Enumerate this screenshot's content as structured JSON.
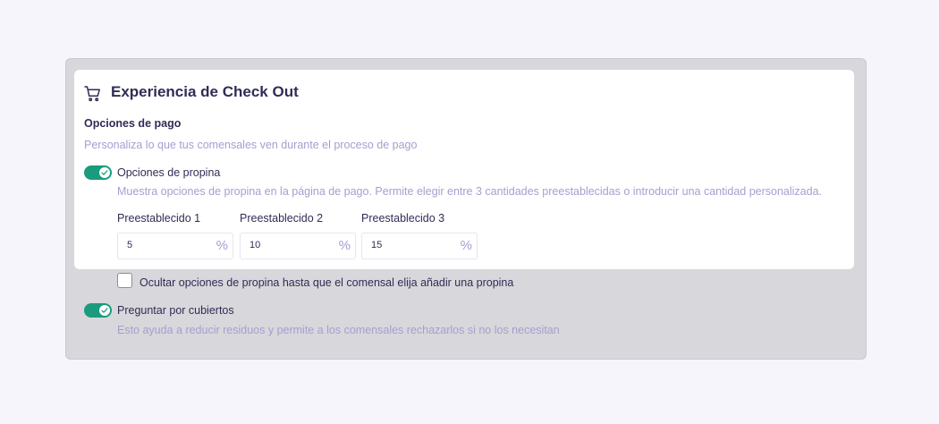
{
  "card": {
    "title": "Experiencia de Check Out",
    "icon": "cart-icon"
  },
  "payment": {
    "heading": "Opciones de pago",
    "description": "Personaliza lo que tus comensales ven durante el proceso de pago"
  },
  "tips": {
    "toggle_on": true,
    "label": "Opciones de propina",
    "description": "Muestra opciones de propina en la página de pago. Permite elegir entre 3 cantidades preestablecidas o introducir una cantidad personalizada.",
    "presets": [
      {
        "label": "Preestablecido 1",
        "value": "5",
        "unit": "%"
      },
      {
        "label": "Preestablecido 2",
        "value": "10",
        "unit": "%"
      },
      {
        "label": "Preestablecido 3",
        "value": "15",
        "unit": "%"
      }
    ],
    "hide_checkbox": {
      "checked": false,
      "label": "Ocultar opciones de propina hasta que el comensal elija añadir una propina"
    }
  },
  "cutlery": {
    "toggle_on": true,
    "label": "Preguntar por cubiertos",
    "description": "Esto ayuda a reducir residuos y permite a los comensales rechazarlos si no los necesitan"
  },
  "colors": {
    "accent": "#1a9b7d",
    "text_primary": "#2f2d55",
    "text_secondary": "#a49fd0",
    "overlay": "#d8d7db"
  }
}
